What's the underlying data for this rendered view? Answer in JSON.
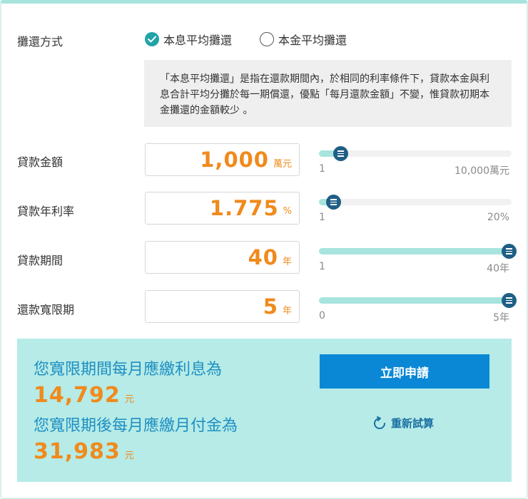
{
  "repayment": {
    "label": "攤還方式",
    "options": [
      {
        "label": "本息平均攤還",
        "selected": true
      },
      {
        "label": "本金平均攤還",
        "selected": false
      }
    ],
    "description": "「本息平均攤還」是指在還款期間內，於相同的利率條件下，貸款本金與利息合計平均分攤於每一期償還，優點「每月還款金額」不變，惟貸款初期本金攤還的金額較少 。"
  },
  "fields": [
    {
      "label": "貸款金額",
      "value": "1,000",
      "unit": "萬元",
      "min_label": "1",
      "max_label": "10,000萬元",
      "fill_fraction": 0.1
    },
    {
      "label": "貸款年利率",
      "value": "1.775",
      "unit": "%",
      "min_label": "1",
      "max_label": "20%",
      "fill_fraction": 0.06
    },
    {
      "label": "貸款期間",
      "value": "40",
      "unit": "年",
      "min_label": "1",
      "max_label": "40年",
      "fill_fraction": 1.0
    },
    {
      "label": "還款寬限期",
      "value": "5",
      "unit": "年",
      "min_label": "0",
      "max_label": "5年",
      "fill_fraction": 1.0
    }
  ],
  "result": {
    "grace_label": "您寬限期間每月應繳利息為",
    "grace_amount": "14,792",
    "after_label": "您寬限期後每月應繳月付金為",
    "after_amount": "31,983",
    "currency": "元",
    "apply_label": "立即申請",
    "recalc_label": "重新試算"
  },
  "colors": {
    "accent_orange": "#f08a1c",
    "slider_fill": "#a8e4de",
    "slider_knob": "#1f5f86",
    "result_bg": "#b6ebe7",
    "result_text": "#1f8fc2",
    "apply_button": "#0a88d6",
    "radio_checked": "#21a3a8"
  }
}
